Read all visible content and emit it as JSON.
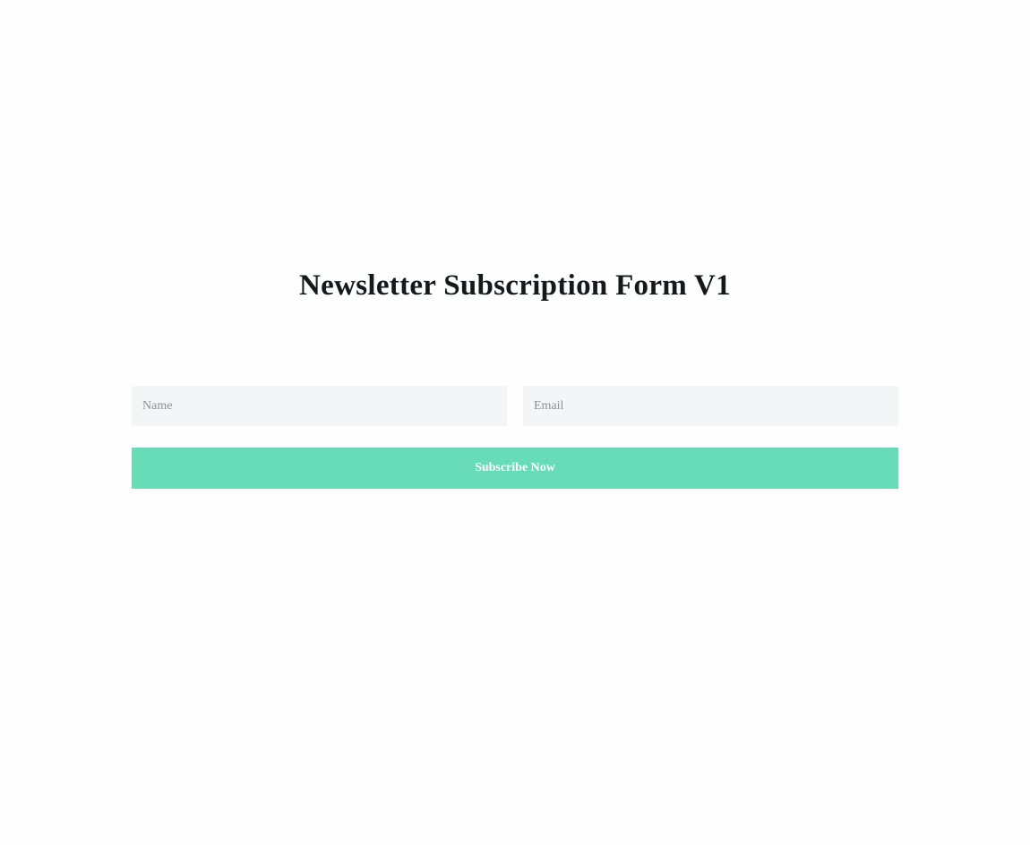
{
  "page": {
    "title": "Newsletter Subscription Form V1"
  },
  "form": {
    "name_placeholder": "Name",
    "name_value": "",
    "email_placeholder": "Email",
    "email_value": "",
    "submit_label": "Subscribe Now"
  },
  "colors": {
    "background": "#fefefe",
    "title_text": "#16191c",
    "field_background": "#f3f6f7",
    "placeholder_text": "#8c9196",
    "button_background": "#68dbb7",
    "button_text": "#ffffff"
  }
}
